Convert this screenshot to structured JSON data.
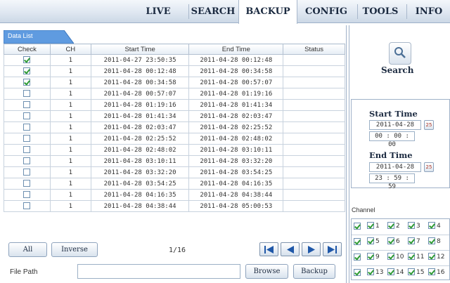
{
  "nav": {
    "tabs": [
      {
        "label": "LIVE"
      },
      {
        "label": "SEARCH"
      },
      {
        "label": "BACKUP"
      },
      {
        "label": "CONFIG"
      },
      {
        "label": "TOOLS"
      },
      {
        "label": "INFO"
      }
    ],
    "active": "BACKUP"
  },
  "data_list": {
    "tab_label": "Data List",
    "columns": [
      "Check",
      "CH",
      "Start Time",
      "End Time",
      "Status"
    ],
    "rows": [
      {
        "checked": true,
        "ch": "1",
        "start": "2011-04-27 23:50:35",
        "end": "2011-04-28 00:12:48",
        "status": ""
      },
      {
        "checked": true,
        "ch": "1",
        "start": "2011-04-28 00:12:48",
        "end": "2011-04-28 00:34:58",
        "status": ""
      },
      {
        "checked": true,
        "ch": "1",
        "start": "2011-04-28 00:34:58",
        "end": "2011-04-28 00:57:07",
        "status": ""
      },
      {
        "checked": false,
        "ch": "1",
        "start": "2011-04-28 00:57:07",
        "end": "2011-04-28 01:19:16",
        "status": ""
      },
      {
        "checked": false,
        "ch": "1",
        "start": "2011-04-28 01:19:16",
        "end": "2011-04-28 01:41:34",
        "status": ""
      },
      {
        "checked": false,
        "ch": "1",
        "start": "2011-04-28 01:41:34",
        "end": "2011-04-28 02:03:47",
        "status": ""
      },
      {
        "checked": false,
        "ch": "1",
        "start": "2011-04-28 02:03:47",
        "end": "2011-04-28 02:25:52",
        "status": ""
      },
      {
        "checked": false,
        "ch": "1",
        "start": "2011-04-28 02:25:52",
        "end": "2011-04-28 02:48:02",
        "status": ""
      },
      {
        "checked": false,
        "ch": "1",
        "start": "2011-04-28 02:48:02",
        "end": "2011-04-28 03:10:11",
        "status": ""
      },
      {
        "checked": false,
        "ch": "1",
        "start": "2011-04-28 03:10:11",
        "end": "2011-04-28 03:32:20",
        "status": ""
      },
      {
        "checked": false,
        "ch": "1",
        "start": "2011-04-28 03:32:20",
        "end": "2011-04-28 03:54:25",
        "status": ""
      },
      {
        "checked": false,
        "ch": "1",
        "start": "2011-04-28 03:54:25",
        "end": "2011-04-28 04:16:35",
        "status": ""
      },
      {
        "checked": false,
        "ch": "1",
        "start": "2011-04-28 04:16:35",
        "end": "2011-04-28 04:38:44",
        "status": ""
      },
      {
        "checked": false,
        "ch": "1",
        "start": "2011-04-28 04:38:44",
        "end": "2011-04-28 05:00:53",
        "status": ""
      }
    ]
  },
  "controls": {
    "all_label": "All",
    "inverse_label": "Inverse",
    "page_indicator": "1/16",
    "file_path_label": "File Path",
    "file_path_value": "",
    "browse_label": "Browse",
    "backup_label": "Backup"
  },
  "search": {
    "label": "Search"
  },
  "time": {
    "start_title": "Start Time",
    "start_date": "2011-04-28",
    "start_time": "00 : 00 : 00",
    "end_title": "End Time",
    "end_date": "2011-04-28",
    "end_time": "23 : 59 : 59",
    "calendar_label": "25"
  },
  "channel": {
    "label": "Channel",
    "rows": [
      {
        "row_checked": true,
        "channels": [
          {
            "n": "1",
            "checked": true
          },
          {
            "n": "2",
            "checked": true
          },
          {
            "n": "3",
            "checked": true
          },
          {
            "n": "4",
            "checked": true
          }
        ]
      },
      {
        "row_checked": true,
        "channels": [
          {
            "n": "5",
            "checked": true
          },
          {
            "n": "6",
            "checked": true
          },
          {
            "n": "7",
            "checked": true
          },
          {
            "n": "8",
            "checked": true
          }
        ]
      },
      {
        "row_checked": true,
        "channels": [
          {
            "n": "9",
            "checked": true
          },
          {
            "n": "10",
            "checked": true
          },
          {
            "n": "11",
            "checked": true
          },
          {
            "n": "12",
            "checked": true
          }
        ]
      },
      {
        "row_checked": true,
        "channels": [
          {
            "n": "13",
            "checked": true
          },
          {
            "n": "14",
            "checked": true
          },
          {
            "n": "15",
            "checked": true
          },
          {
            "n": "16",
            "checked": true
          }
        ]
      }
    ]
  }
}
